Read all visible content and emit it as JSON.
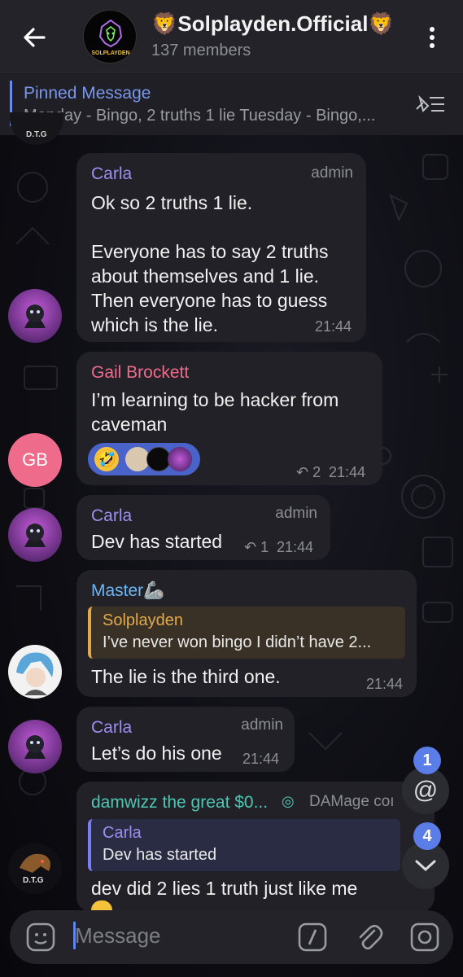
{
  "header": {
    "title": "🦁Solplayden.Official🦁",
    "members": "137 members",
    "avatar_text": "SOLPLAYDEN"
  },
  "pinned": {
    "title": "Pinned Message",
    "text": "Monday - Bingo, 2 truths 1 lie Tuesday - Bingo,..."
  },
  "messages": [
    {
      "sender": "Carla",
      "role": "admin",
      "text": "Ok so 2 truths 1 lie.\n\nEveryone has to say 2 truths about themselves and 1 lie. Then everyone has to guess which is the lie.",
      "time": "21:44"
    },
    {
      "sender": "Gail Brockett",
      "avatar_initials": "GB",
      "text": "I’m learning to be hacker from caveman",
      "reply_count": "2",
      "time": "21:44"
    },
    {
      "sender": "Carla",
      "role": "admin",
      "text": "Dev has started",
      "reply_count": "1",
      "time": "21:44"
    },
    {
      "sender": "Master🦾",
      "reply_sender": "Solplayden",
      "reply_text": "I’ve never won bingo  I didn’t have 2...",
      "text": "The lie is the third one.",
      "time": "21:44"
    },
    {
      "sender": "Carla",
      "role": "admin",
      "text": "Let’s do his one",
      "time": "21:44"
    },
    {
      "sender": "damwizz the great $0...",
      "role": "DAMage coı",
      "reply_sender": "Carla",
      "reply_text": "Dev has started",
      "text": "dev did 2 lies 1 truth just like me",
      "avatar_text": "D.T.G"
    }
  ],
  "fabs": {
    "mentions_badge": "1",
    "scroll_badge": "4"
  },
  "composer": {
    "placeholder": "Message"
  },
  "colors": {
    "accent": "#5a7de8",
    "carla": "#9c8ff0",
    "gail": "#ee6b8b",
    "master": "#6fb6f4",
    "solplayden": "#e2a94c",
    "damwizz": "#4fc6b3"
  }
}
